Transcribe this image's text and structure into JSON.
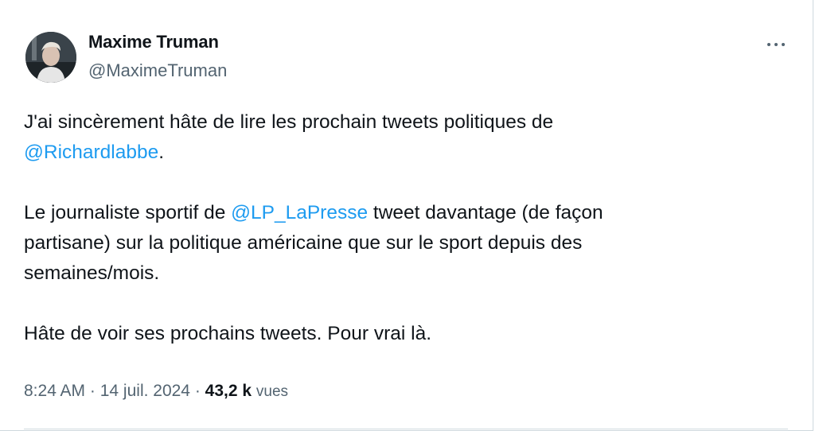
{
  "author": {
    "display_name": "Maxime Truman",
    "handle": "@MaximeTruman"
  },
  "tweet": {
    "line1_text": "J'ai sincèrement hâte de lire les prochain tweets politiques de",
    "mention1": "@Richardlabbe",
    "mention1_suffix": ".",
    "para2_prefix": "Le journaliste sportif de ",
    "mention2": "@LP_LaPresse",
    "para2_line1_suffix": " tweet davantage (de façon",
    "para2_line2": "partisane) sur la politique américaine que sur le sport depuis des",
    "para2_line3": "semaines/mois.",
    "para3": "Hâte de voir ses prochains tweets. Pour vrai là."
  },
  "meta": {
    "time": "8:24 AM",
    "separator": " · ",
    "date": "14 juil. 2024",
    "views_count": "43,2 k",
    "views_label": "vues"
  },
  "colors": {
    "link": "#1d9bf0",
    "secondary": "#536471",
    "primary": "#0f1419"
  },
  "icons": {
    "more": "more-options-icon"
  }
}
